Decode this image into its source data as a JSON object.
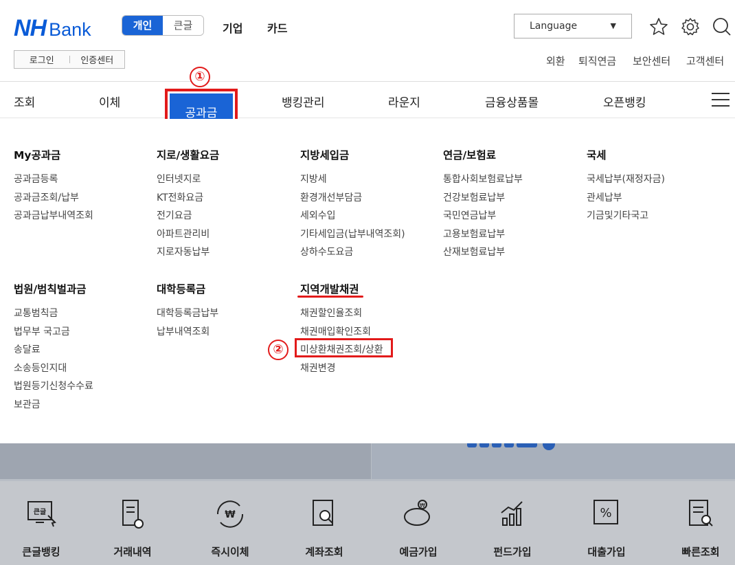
{
  "header": {
    "logo_nh": "NH",
    "logo_bank": "Bank",
    "segment": {
      "active": "개인",
      "inactive": "큰글"
    },
    "top_nav": [
      "기업",
      "카드"
    ],
    "language": {
      "label": "Language",
      "caret": "▼"
    },
    "login": {
      "login": "로그인",
      "cert": "인증센터"
    },
    "utility": [
      "외환",
      "퇴직연금",
      "보안센터",
      "고객센터"
    ]
  },
  "main_nav": {
    "items": [
      "조회",
      "이체",
      "공과금",
      "뱅킹관리",
      "라운지",
      "금융상품몰",
      "오픈뱅킹"
    ],
    "active_index": 2
  },
  "markers": {
    "one": "①",
    "two": "②"
  },
  "menu": {
    "row1": [
      {
        "title": "My공과금",
        "items": [
          "공과금등록",
          "공과금조회/납부",
          "공과금납부내역조회"
        ]
      },
      {
        "title": "지로/생활요금",
        "items": [
          "인터넷지로",
          "KT전화요금",
          "전기요금",
          "아파트관리비",
          "지로자동납부"
        ]
      },
      {
        "title": "지방세입금",
        "items": [
          "지방세",
          "환경개선부담금",
          "세외수입",
          "기타세입금(납부내역조회)",
          "상하수도요금"
        ]
      },
      {
        "title": "연금/보험료",
        "items": [
          "통합사회보험료납부",
          "건강보험료납부",
          "국민연금납부",
          "고용보험료납부",
          "산재보험료납부"
        ]
      },
      {
        "title": "국세",
        "items": [
          "국세납부(재정자금)",
          "관세납부",
          "기금및기타국고"
        ]
      }
    ],
    "row2": [
      {
        "title": "법원/범칙벌과금",
        "items": [
          "교통범칙금",
          "법무부 국고금",
          "송달료",
          "소송등인지대",
          "법원등기신청수수료",
          "보관금"
        ]
      },
      {
        "title": "대학등록금",
        "items": [
          "대학등록금납부",
          "납부내역조회"
        ]
      },
      {
        "title": "지역개발채권",
        "items": [
          "채권할인율조회",
          "채권매입확인조회",
          "미상환채권조회/상환",
          "채권변경"
        ]
      }
    ]
  },
  "quick_menu": [
    {
      "label": "큰글뱅킹",
      "icon": "large-text-banking-icon",
      "icon_text": "큰글"
    },
    {
      "label": "거래내역",
      "icon": "transaction-history-icon"
    },
    {
      "label": "즉시이체",
      "icon": "instant-transfer-icon",
      "icon_text": "₩"
    },
    {
      "label": "계좌조회",
      "icon": "account-inquiry-icon"
    },
    {
      "label": "예금가입",
      "icon": "deposit-piggy-icon",
      "icon_text": "₩"
    },
    {
      "label": "펀드가입",
      "icon": "fund-chart-icon"
    },
    {
      "label": "대출가입",
      "icon": "loan-percent-icon",
      "icon_text": "%"
    },
    {
      "label": "빠른조회",
      "icon": "quick-inquiry-icon"
    }
  ],
  "colors": {
    "brand": "#0a5bd7",
    "active": "#1a64d6",
    "highlight": "#e21a1a"
  }
}
